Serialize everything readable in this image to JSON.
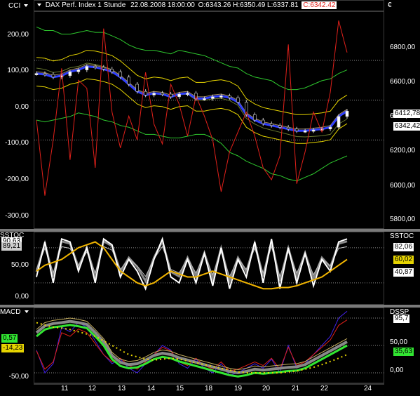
{
  "colors": {
    "background": "#000000",
    "up_candle": "#ffffff",
    "down_candle": "#000000",
    "cci": "#e0201a",
    "band_green": "#2ec82e",
    "band_yellow": "#e6d400",
    "macd_green": "#32e632",
    "price_blue": "#3040ff",
    "price_label_bg": "#ffffff"
  },
  "header": {
    "menu_label": "CCI",
    "title": "DAX Perf. Index 1 Stunde",
    "datetime": "22.08.2008 18:00:00",
    "ohlc": "O:6343.26 H:6350.49 L:6337.81",
    "close": "C:6342.42",
    "currency": "€"
  },
  "panels": {
    "main": {
      "indicator_label": "CCI",
      "left_ticks": [
        "200,00",
        "100,00",
        "0,00",
        "-100,00",
        "-200,00",
        "-300,00"
      ],
      "right_ticks": [
        "6800,00",
        "6600,00",
        "6400,00",
        "6200,00",
        "6000,00",
        "5800,00"
      ],
      "price_labels": [
        "6412,78",
        "6342,42"
      ]
    },
    "sstoc": {
      "indicator_label": "SSTOC",
      "right_label": "SSTOC",
      "left_ticks": [
        "50,00",
        "0,00"
      ],
      "left_values": [
        "90,63",
        "89,21"
      ],
      "right_values": [
        "82,06",
        "60,02",
        "40,87"
      ]
    },
    "macd": {
      "indicator_label": "MACD",
      "right_label": "DSSP",
      "left_ticks": [
        "-50,00"
      ],
      "left_values": [
        "0,57",
        "-14,23"
      ],
      "right_values": [
        "95,7",
        "35,63"
      ],
      "right_ticks": [
        "50,00",
        "0,00"
      ]
    }
  },
  "x_axis": {
    "ticks": [
      "11",
      "12",
      "13",
      "14",
      "15",
      "18",
      "19",
      "20",
      "21",
      "22",
      "24"
    ]
  },
  "chart_data": [
    {
      "type": "line",
      "name": "main",
      "y_price_range": [
        5700,
        6900
      ],
      "y_cci_range": [
        -320,
        220
      ],
      "series": [
        {
          "name": "close",
          "values": [
            6560,
            6555,
            6540,
            6548,
            6570,
            6580,
            6600,
            6595,
            6585,
            6570,
            6540,
            6500,
            6460,
            6440,
            6450,
            6445,
            6430,
            6445,
            6450,
            6420,
            6420,
            6430,
            6435,
            6425,
            6400,
            6330,
            6300,
            6280,
            6270,
            6260,
            6250,
            6240,
            6240,
            6245,
            6250,
            6260,
            6320,
            6350
          ]
        },
        {
          "name": "cci",
          "values": [
            -50,
            -240,
            -100,
            80,
            -150,
            50,
            30,
            -170,
            180,
            -30,
            -120,
            -40,
            -100,
            70,
            -60,
            -110,
            40,
            -10,
            -90,
            10,
            -40,
            -100,
            -230,
            -130,
            -80,
            -30,
            -90,
            -170,
            -200,
            -140,
            140,
            -210,
            -130,
            -30,
            -80,
            20,
            200,
            120
          ]
        },
        {
          "name": "upper_green",
          "values": [
            6820,
            6800,
            6800,
            6780,
            6780,
            6790,
            6800,
            6790,
            6790,
            6770,
            6750,
            6720,
            6700,
            6690,
            6690,
            6680,
            6670,
            6690,
            6680,
            6670,
            6660,
            6640,
            6620,
            6600,
            6590,
            6560,
            6540,
            6530,
            6520,
            6490,
            6470,
            6470,
            6480,
            6500,
            6520,
            6530,
            6560,
            6580
          ]
        },
        {
          "name": "lower_green",
          "values": [
            6300,
            6290,
            6300,
            6310,
            6320,
            6340,
            6330,
            6320,
            6300,
            6290,
            6270,
            6260,
            6240,
            6220,
            6220,
            6210,
            6200,
            6200,
            6210,
            6220,
            6220,
            6200,
            6170,
            6120,
            6100,
            6070,
            6050,
            6030,
            6000,
            5990,
            5970,
            5960,
            5980,
            6000,
            6030,
            6060,
            6080,
            6100
          ]
        }
      ]
    },
    {
      "type": "line",
      "name": "sstoc",
      "y_range": [
        -15,
        105
      ],
      "series": [
        {
          "name": "fast",
          "values": [
            30,
            90,
            20,
            95,
            90,
            40,
            80,
            20,
            95,
            85,
            30,
            60,
            40,
            10,
            60,
            95,
            30,
            20,
            60,
            20,
            70,
            15,
            80,
            10,
            60,
            30,
            90,
            20,
            95,
            10,
            80,
            20,
            70,
            15,
            60,
            40,
            90,
            95
          ]
        },
        {
          "name": "slow_yellow",
          "values": [
            40,
            50,
            55,
            60,
            70,
            80,
            85,
            90,
            80,
            60,
            40,
            30,
            20,
            15,
            20,
            30,
            40,
            35,
            30,
            30,
            35,
            40,
            35,
            30,
            25,
            20,
            15,
            10,
            10,
            12,
            12,
            15,
            20,
            25,
            30,
            40,
            50,
            60
          ]
        }
      ]
    },
    {
      "type": "line",
      "name": "macd",
      "y_range": [
        -60,
        100
      ],
      "series": [
        {
          "name": "macd_green",
          "values": [
            40,
            55,
            60,
            62,
            65,
            62,
            58,
            40,
            20,
            -10,
            -25,
            -30,
            -28,
            -20,
            -10,
            -5,
            -8,
            -15,
            -20,
            -25,
            -30,
            -35,
            -40,
            -45,
            -48,
            -45,
            -40,
            -42,
            -40,
            -38,
            -36,
            -35,
            -30,
            -20,
            -10,
            0,
            10,
            20
          ]
        },
        {
          "name": "signal_dotted",
          "values": [
            70,
            65,
            60,
            58,
            55,
            50,
            45,
            40,
            30,
            20,
            10,
            0,
            -5,
            -10,
            -12,
            -10,
            -8,
            -10,
            -14,
            -18,
            -22,
            -26,
            -30,
            -34,
            -38,
            -40,
            -40,
            -40,
            -40,
            -40,
            -38,
            -36,
            -32,
            -28,
            -22,
            -15,
            -8,
            0
          ]
        },
        {
          "name": "dssp_red",
          "values": [
            10,
            -40,
            -20,
            60,
            50,
            70,
            60,
            30,
            0,
            -20,
            -10,
            -30,
            -40,
            -20,
            0,
            20,
            10,
            -20,
            -30,
            -10,
            -30,
            -40,
            -20,
            -45,
            -40,
            -30,
            -20,
            -30,
            -10,
            -40,
            20,
            -30,
            -20,
            0,
            20,
            40,
            80,
            95
          ]
        }
      ]
    }
  ]
}
